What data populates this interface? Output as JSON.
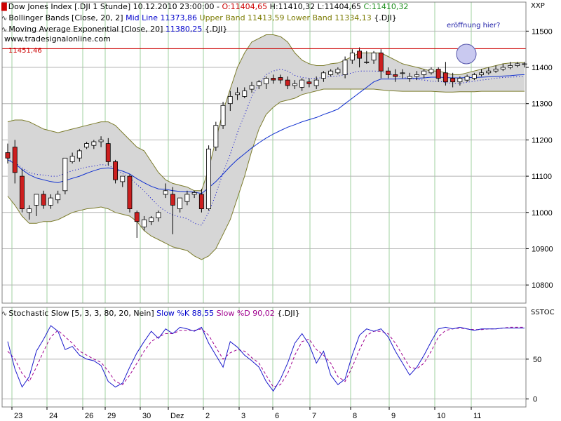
{
  "header": {
    "line1": {
      "name": "Dow Jones Index [.DJI  1 Stunde]",
      "datetime": "10.12.2010 23:00:00 -",
      "open": "O:11404,65",
      "high": "H:11410,32",
      "low": "L:11404,65",
      "close": "C:11410,32"
    },
    "line2": {
      "name": "Bollinger Bands [Close, 20, 2]",
      "mid": "Mid Line 11373,86",
      "upper": "Upper Band 11413,59",
      "lower": "Lower Band 11334,13",
      "symbol": "{.DJI}"
    },
    "line3": {
      "name": "Moving Average Exponential [Close, 20]",
      "value": "11380,25",
      "symbol": "{.DJI}"
    },
    "website": "www.tradesignalonline.com"
  },
  "symbol_main": "XXP",
  "symbol_osc": "SSTOC",
  "hline_label": "11451,46",
  "annotation": "eröffnung hier?",
  "oscillator": {
    "name": "Stochastic Slow [5, 3, 3, 80, 20, Nein]",
    "k_label": "Slow %K 88,55",
    "d_label": "Slow %D 90,02",
    "symbol": "{.DJI}"
  },
  "colors": {
    "up_candle": "#ffffff",
    "down_candle": "#cc1f1f",
    "bollinger_fill": "#d6d6d6",
    "bollinger_line": "#7c7c2c",
    "mid_line": "#0000cc",
    "ema_line": "#1030d0",
    "hline": "#cc0000",
    "grid_v": "#9fd29f",
    "grid_h": "#b4b4b4",
    "stoch_k": "#1a1acc",
    "stoch_d": "#a0008f",
    "circle_fill": "#c9c9f0",
    "circle_stroke": "#5555aa"
  },
  "chart_data": [
    {
      "type": "line",
      "title": "Dow Jones Index [.DJI 1 Stunde]",
      "x_tick_labels": [
        "23",
        "24",
        "26",
        "29",
        "30",
        "Dez",
        "2",
        "3",
        "6",
        "7",
        "8",
        "9",
        "10",
        "11"
      ],
      "y_ticks": [
        10800,
        10900,
        11000,
        11100,
        11200,
        11300,
        11400,
        11500
      ],
      "ylim": [
        10750,
        11580
      ],
      "horizontal_line": 11451.46,
      "grid": true,
      "candles": {
        "open": [
          11165,
          11180,
          11100,
          11000,
          11020,
          11050,
          11020,
          11035,
          11060,
          11140,
          11150,
          11180,
          11185,
          11195,
          11190,
          11140,
          11085,
          11100,
          11000,
          10960,
          10975,
          10985,
          11050,
          11050,
          11010,
          11030,
          11050,
          11050,
          11010,
          11180,
          11240,
          11300,
          11325,
          11320,
          11340,
          11350,
          11355,
          11370,
          11372,
          11365,
          11350,
          11345,
          11360,
          11350,
          11370,
          11380,
          11385,
          11380,
          11420,
          11445,
          11415,
          11420,
          11440,
          11390,
          11380,
          11385,
          11370,
          11375,
          11380,
          11385,
          11395,
          11385,
          11370,
          11360,
          11365,
          11370,
          11380,
          11385,
          11390,
          11395,
          11400,
          11405,
          11410
        ],
        "high": [
          11190,
          11200,
          11120,
          11020,
          11040,
          11060,
          11050,
          11060,
          11150,
          11165,
          11175,
          11195,
          11200,
          11210,
          11205,
          11145,
          11100,
          11105,
          11005,
          10990,
          10990,
          11005,
          11080,
          11070,
          11040,
          11060,
          11060,
          11065,
          11185,
          11250,
          11305,
          11335,
          11345,
          11345,
          11360,
          11365,
          11375,
          11380,
          11380,
          11375,
          11365,
          11370,
          11370,
          11375,
          11390,
          11395,
          11400,
          11430,
          11450,
          11455,
          11445,
          11445,
          11450,
          11400,
          11395,
          11395,
          11385,
          11390,
          11395,
          11400,
          11400,
          11415,
          11385,
          11375,
          11380,
          11385,
          11395,
          11400,
          11405,
          11410,
          11415,
          11415,
          11415
        ],
        "low": [
          11135,
          11080,
          11000,
          10980,
          10990,
          11010,
          11010,
          11025,
          11050,
          11135,
          11140,
          11175,
          11175,
          11180,
          11130,
          11080,
          11070,
          11000,
          10930,
          10950,
          10965,
          10975,
          11040,
          10940,
          11000,
          11020,
          11040,
          11000,
          11005,
          11170,
          11230,
          11280,
          11310,
          11315,
          11330,
          11340,
          11340,
          11355,
          11355,
          11340,
          11340,
          11335,
          11345,
          11340,
          11360,
          11375,
          11380,
          11370,
          11410,
          11400,
          11410,
          11410,
          11370,
          11370,
          11360,
          11370,
          11360,
          11365,
          11370,
          11380,
          11360,
          11350,
          11345,
          11350,
          11360,
          11365,
          11375,
          11380,
          11385,
          11390,
          11395,
          11400,
          11400
        ],
        "close": [
          11150,
          11110,
          11010,
          11010,
          11050,
          11020,
          11040,
          11050,
          11150,
          11155,
          11170,
          11190,
          11195,
          11200,
          11140,
          11090,
          11100,
          11010,
          10975,
          10980,
          10985,
          11000,
          11060,
          11020,
          11040,
          11050,
          11055,
          11010,
          11175,
          11240,
          11295,
          11320,
          11330,
          11335,
          11350,
          11360,
          11370,
          11365,
          11365,
          11350,
          11355,
          11365,
          11355,
          11365,
          11385,
          11390,
          11395,
          11420,
          11440,
          11425,
          11415,
          11440,
          11390,
          11380,
          11375,
          11385,
          11375,
          11380,
          11390,
          11395,
          11370,
          11360,
          11360,
          11370,
          11375,
          11380,
          11385,
          11390,
          11395,
          11400,
          11405,
          11410,
          11410
        ]
      },
      "series": [
        {
          "name": "Upper Band",
          "values": [
            11250,
            11255,
            11255,
            11250,
            11240,
            11230,
            11225,
            11220,
            11225,
            11230,
            11235,
            11240,
            11245,
            11250,
            11250,
            11240,
            11220,
            11200,
            11180,
            11170,
            11140,
            11110,
            11090,
            11080,
            11075,
            11070,
            11060,
            11060,
            11120,
            11200,
            11280,
            11340,
            11400,
            11440,
            11470,
            11480,
            11490,
            11490,
            11485,
            11470,
            11440,
            11420,
            11410,
            11405,
            11405,
            11410,
            11412,
            11420,
            11430,
            11440,
            11440,
            11440,
            11440,
            11430,
            11420,
            11410,
            11405,
            11400,
            11395,
            11390,
            11390,
            11385,
            11380,
            11380,
            11385,
            11390,
            11395,
            11400,
            11405,
            11410,
            11412,
            11413,
            11413
          ]
        },
        {
          "name": "Lower Band",
          "values": [
            11045,
            11020,
            10990,
            10970,
            10970,
            10975,
            10975,
            10980,
            10990,
            11000,
            11005,
            11010,
            11012,
            11015,
            11010,
            11000,
            10995,
            10990,
            10975,
            10950,
            10935,
            10925,
            10915,
            10905,
            10900,
            10895,
            10880,
            10870,
            10880,
            10900,
            10940,
            10980,
            11040,
            11100,
            11170,
            11230,
            11270,
            11290,
            11305,
            11310,
            11315,
            11325,
            11330,
            11335,
            11340,
            11340,
            11340,
            11340,
            11340,
            11340,
            11340,
            11340,
            11338,
            11336,
            11335,
            11334,
            11334,
            11334,
            11334,
            11334,
            11333,
            11332,
            11332,
            11333,
            11333,
            11333,
            11334,
            11334,
            11334,
            11334,
            11334,
            11334,
            11334
          ]
        },
        {
          "name": "Mid Line",
          "values": [
            11148,
            11138,
            11123,
            11110,
            11105,
            11103,
            11100,
            11100,
            11108,
            11115,
            11120,
            11125,
            11128,
            11132,
            11130,
            11120,
            11107,
            11095,
            11077,
            11060,
            11038,
            11018,
            11003,
            10993,
            10988,
            10983,
            10970,
            10965,
            11000,
            11050,
            11110,
            11160,
            11220,
            11270,
            11320,
            11355,
            11380,
            11390,
            11395,
            11390,
            11378,
            11372,
            11370,
            11370,
            11372,
            11375,
            11376,
            11380,
            11385,
            11390,
            11390,
            11390,
            11389,
            11383,
            11378,
            11372,
            11370,
            11367,
            11365,
            11362,
            11362,
            11358,
            11356,
            11356,
            11359,
            11362,
            11365,
            11367,
            11370,
            11372,
            11373,
            11374,
            11374
          ]
        },
        {
          "name": "EMA 20",
          "values": [
            11145,
            11135,
            11118,
            11104,
            11095,
            11090,
            11085,
            11082,
            11088,
            11094,
            11100,
            11108,
            11115,
            11121,
            11123,
            11120,
            11114,
            11106,
            11093,
            11082,
            11072,
            11065,
            11064,
            11060,
            11058,
            11057,
            11056,
            11052,
            11068,
            11085,
            11106,
            11127,
            11146,
            11162,
            11178,
            11192,
            11205,
            11216,
            11226,
            11235,
            11242,
            11250,
            11256,
            11262,
            11270,
            11277,
            11285,
            11300,
            11315,
            11330,
            11345,
            11360,
            11368,
            11368,
            11368,
            11369,
            11369,
            11370,
            11371,
            11373,
            11373,
            11372,
            11371,
            11371,
            11372,
            11372,
            11373,
            11374,
            11375,
            11376,
            11377,
            11379,
            11380
          ]
        }
      ]
    },
    {
      "type": "line",
      "title": "Stochastic Slow [5, 3, 3, 80, 20, Nein]",
      "y_ticks": [
        0,
        50
      ],
      "ylim": [
        -10,
        115
      ],
      "series": [
        {
          "name": "Slow %K",
          "values": [
            72,
            38,
            15,
            28,
            60,
            75,
            92,
            85,
            62,
            66,
            55,
            50,
            48,
            42,
            22,
            15,
            20,
            40,
            58,
            72,
            85,
            76,
            88,
            82,
            90,
            88,
            85,
            90,
            70,
            55,
            40,
            72,
            65,
            55,
            48,
            40,
            22,
            10,
            25,
            45,
            70,
            82,
            68,
            45,
            60,
            30,
            18,
            25,
            55,
            80,
            88,
            85,
            88,
            78,
            60,
            45,
            30,
            40,
            55,
            72,
            88,
            90,
            88,
            90,
            88,
            86,
            88,
            88,
            88,
            89,
            89,
            89,
            89
          ]
        },
        {
          "name": "Slow %D",
          "values": [
            60,
            50,
            32,
            22,
            40,
            60,
            78,
            86,
            78,
            70,
            60,
            55,
            50,
            46,
            35,
            22,
            18,
            30,
            45,
            60,
            72,
            78,
            82,
            82,
            86,
            86,
            86,
            88,
            80,
            65,
            50,
            58,
            62,
            60,
            52,
            45,
            30,
            15,
            18,
            32,
            55,
            72,
            75,
            62,
            55,
            45,
            28,
            22,
            40,
            62,
            80,
            85,
            85,
            82,
            70,
            55,
            40,
            38,
            45,
            60,
            78,
            86,
            88,
            89,
            88,
            87,
            87,
            88,
            88,
            89,
            90,
            90,
            90
          ]
        }
      ]
    }
  ]
}
